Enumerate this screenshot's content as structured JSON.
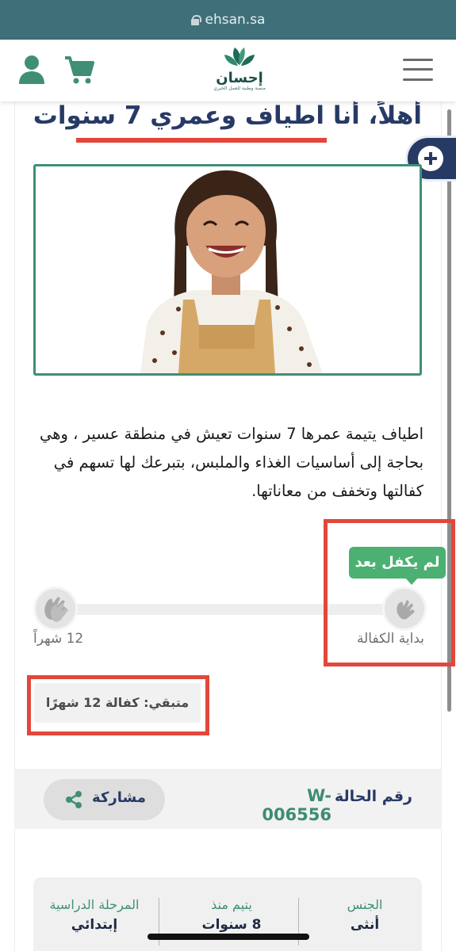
{
  "browser": {
    "url": "ehsan.sa"
  },
  "header": {
    "logo_text": "إحسان",
    "logo_subtitle": "منصة وطنية للعمل الخيري",
    "icons": [
      "hamburger-icon",
      "cart-icon",
      "user-icon"
    ]
  },
  "profile": {
    "title": "أهلاً، أنا اطياف وعمري 7 سنوات",
    "description": "اطياف يتيمة عمرها 7 سنوات تعيش في منطقة عسير ، وهي بحاجة إلى أساسيات الغذاء والملبس، بتبرعك لها تسهم في كفالتها وتخفف من معاناتها."
  },
  "progress": {
    "status_badge": "لم يكفل بعد",
    "start_label": "بداية الكفالة",
    "end_label": "12 شهراً",
    "remaining": "متبقي: كفالة 12 شهرًا",
    "completed_fraction": 0
  },
  "case": {
    "label": "رقم الحالة",
    "number": "W-006556",
    "share_label": "مشاركة"
  },
  "info": {
    "gender_label": "الجنس",
    "gender_value": "أنثى",
    "orphan_since_label": "يتيم منذ",
    "orphan_since_value": "8 سنوات",
    "education_label": "المرحلة الدراسية",
    "education_value": "إبتدائي"
  },
  "colors": {
    "url_bar": "#3f7079",
    "brand_navy": "#273a66",
    "brand_green": "#3f8f76",
    "badge_green": "#4bb071",
    "annotation_red": "#e2473b"
  }
}
